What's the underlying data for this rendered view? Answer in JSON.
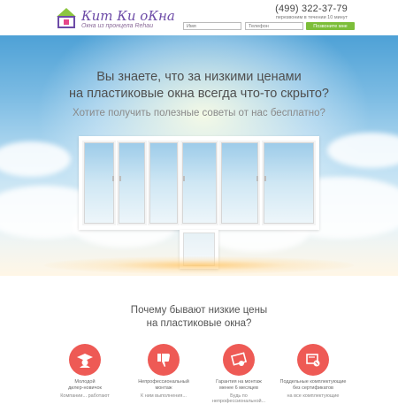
{
  "header": {
    "brand": "Кит Ки оКна",
    "slogan": "Окна из пронцела Rehau",
    "phone": "(499) 322-37-79",
    "callback_note": "перезвоним в течении 10 минут",
    "form": {
      "name_placeholder": "Имя",
      "phone_placeholder": "Телефон",
      "submit_label": "Позвоните мне"
    }
  },
  "hero": {
    "headline_line1": "Вы знаете, что за низкими ценами",
    "headline_line2": "на пластиковые окна всегда что-то скрыто?",
    "subline": "Хотите получить полезные советы от нас бесплатно?"
  },
  "why": {
    "title_line1": "Почему бывают низкие цены",
    "title_line2": "на пластиковые окна?",
    "reasons": [
      {
        "icon": "graduate-icon",
        "label_line1": "Молодой",
        "label_line2": "дилер-новичок",
        "extra": "Компании... работают"
      },
      {
        "icon": "thumbs-down-icon",
        "label_line1": "Непрофессиональный",
        "label_line2": "монтаж",
        "extra": "К ним выполнения..."
      },
      {
        "icon": "certificate-icon",
        "label_line1": "Гарантия на монтаж",
        "label_line2": "менее 6 месяцев",
        "extra": "Будь по непрофессиональной..."
      },
      {
        "icon": "document-warning-icon",
        "label_line1": "Поддельные комплектующие",
        "label_line2": "без сертификатов",
        "extra": "на все комплектующие"
      }
    ]
  },
  "colors": {
    "accent_green": "#7dbe3a",
    "brand_purple": "#6d4ba7",
    "icon_red": "#ee5a55"
  }
}
